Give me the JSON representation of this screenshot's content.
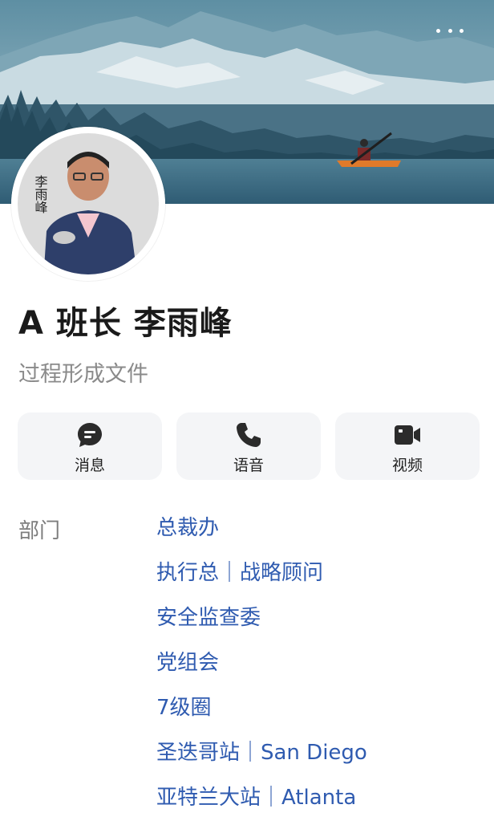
{
  "header": {
    "more_icon": "more-dots-icon",
    "cover_description": "mountain-lake-kayak"
  },
  "profile": {
    "name": "A 班长 李雨峰",
    "subtitle": "过程形成文件",
    "avatar_calligraphy": "李雨峰"
  },
  "actions": [
    {
      "label": "消息",
      "icon": "message-icon"
    },
    {
      "label": "语音",
      "icon": "phone-icon"
    },
    {
      "label": "视频",
      "icon": "video-icon"
    }
  ],
  "department": {
    "label": "部门",
    "items": [
      "总裁办",
      "执行总｜战略顾问",
      "安全监查委",
      "党组会",
      "7级圈",
      "圣迭哥站｜San Diego",
      "亚特兰大站｜Atlanta"
    ]
  },
  "colors": {
    "link": "#2f5bb0",
    "button_bg": "#f4f5f7",
    "icon": "#2b2b2b"
  }
}
